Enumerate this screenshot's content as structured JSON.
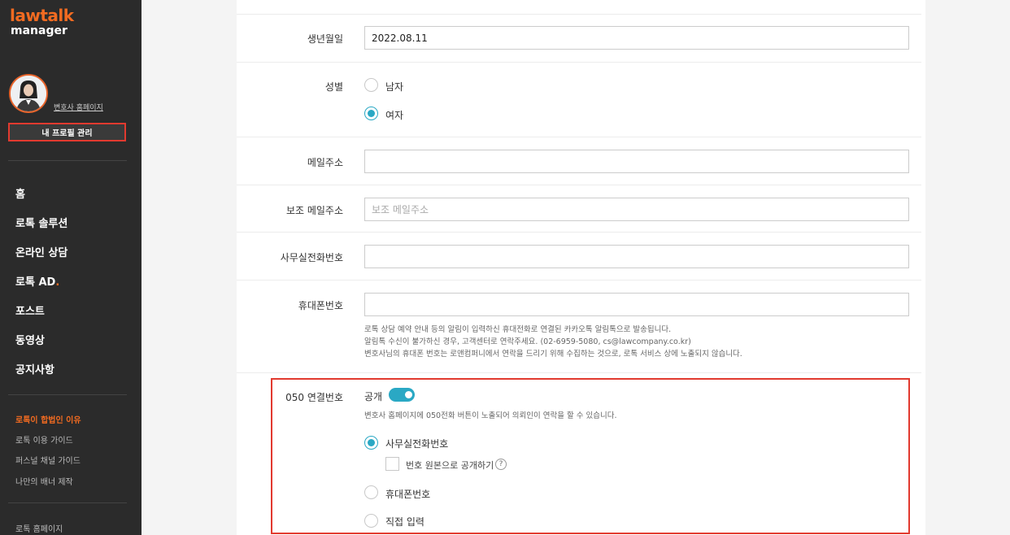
{
  "brand": {
    "line1": "lawtalk",
    "line2": "manager"
  },
  "profile": {
    "homepage_link": "변호사 홈페이지",
    "manage_button": "내 프로필 관리"
  },
  "nav": {
    "main": [
      "홈",
      "로톡 솔루션",
      "온라인 상담",
      "로톡 AD",
      "포스트",
      "동영상",
      "공지사항"
    ],
    "ad_dot": ".",
    "sub": [
      "로톡이 합법인 이유",
      "로톡 이용 가이드",
      "퍼스널 채널 가이드",
      "나만의 배너 제작"
    ],
    "bottom": "로톡 홈페이지"
  },
  "form": {
    "birth": {
      "label": "생년월일",
      "value": "2022.08.11"
    },
    "gender": {
      "label": "성별",
      "options": [
        "남자",
        "여자"
      ],
      "selected": "여자"
    },
    "email": {
      "label": "메일주소",
      "value": ""
    },
    "sub_email": {
      "label": "보조 메일주소",
      "placeholder": "보조 메일주소"
    },
    "office_phone": {
      "label": "사무실전화번호",
      "value": ""
    },
    "mobile": {
      "label": "휴대폰번호",
      "value": "",
      "help": [
        "로톡 상담 예약 안내 등의 알림이 입력하신 휴대전화로 연결된 카카오톡 알림톡으로 발송됩니다.",
        "알림톡 수신이 불가하신 경우, 고객센터로 연락주세요. (02-6959-5080, cs@lawcompany.co.kr)",
        "변호사님의 휴대폰 번호는 로앤컴퍼니에서 연락을 드리기 위해 수집하는 것으로, 로톡 서비스 상에 노출되지 않습니다."
      ]
    },
    "connect050": {
      "label": "050 연결번호",
      "toggle_label": "공개",
      "toggle_on": true,
      "help": "변호사 홈페이지에 050전화 버튼이 노출되어 의뢰인이 연락을 할 수 있습니다.",
      "options": [
        "사무실전화번호",
        "휴대폰번호",
        "직접 입력"
      ],
      "selected": "사무실전화번호",
      "checkbox_label": "번호 원본으로 공개하기",
      "help_icon": "?"
    }
  },
  "colors": {
    "accent": "#f26b21",
    "teal": "#2aa8c4",
    "highlight": "#e23a2f",
    "sidebar": "#2b2b2b"
  }
}
